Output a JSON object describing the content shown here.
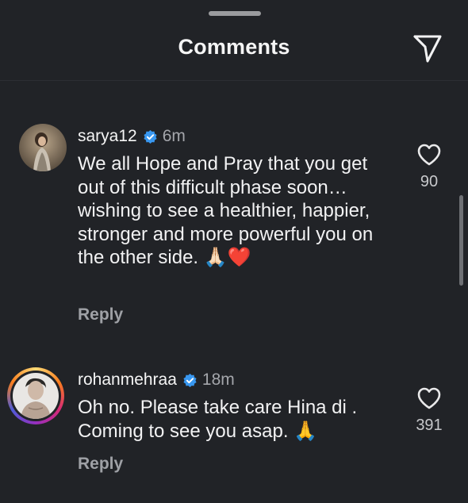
{
  "header": {
    "title": "Comments"
  },
  "comments": [
    {
      "username": "sarya12",
      "time": "6m",
      "text": "We all Hope and Pray that you get out of this difficult phase soon… wishing to see a healthier, happier, stronger and more powerful you on the other side. 🙏🏻❤️",
      "likes": "90",
      "reply_label": "Reply",
      "verified": true
    },
    {
      "username": "rohanmehraa",
      "time": "18m",
      "text": "Oh no. Please take care Hina di . Coming to see you asap. 🙏",
      "likes": "391",
      "reply_label": "Reply",
      "verified": true,
      "has_story": true
    }
  ],
  "colors": {
    "background": "#212327",
    "verified_blue": "#3897f0",
    "secondary_text": "#a4a6ab"
  },
  "icons": {
    "share": "paper-plane-icon",
    "like": "heart-outline-icon",
    "verified": "verified-badge-icon"
  }
}
